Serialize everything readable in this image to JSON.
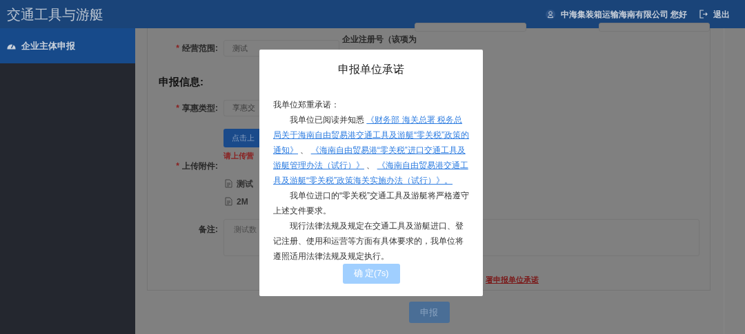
{
  "header": {
    "title": "交通工具与游艇",
    "user": "中海集装箱运输海南有限公司 您好",
    "logout": "退出"
  },
  "sidebar": {
    "items": [
      {
        "label": "企业主体申报",
        "selected": true
      }
    ]
  },
  "form": {
    "scope": {
      "label": "经营范围:",
      "required_mark": "*",
      "value": "测试"
    },
    "reg_label": "企业注册号（该项为",
    "section_title": "申报信息:",
    "type": {
      "label": "享惠类型:",
      "required_mark": "*",
      "value": "享惠交"
    },
    "upload_button": "点击上",
    "upload_hint": "请上传营",
    "attach": {
      "label": "上传附件:",
      "required_mark": "*",
      "files": [
        "测试",
        "2M"
      ]
    },
    "remark": {
      "label": "备注:",
      "value": "测试数"
    },
    "commit_link": "署申报单位承诺",
    "submit": "申报"
  },
  "dialog": {
    "title": "申报单位承诺",
    "paragraphs": [
      {
        "indent": false,
        "parts": [
          {
            "kind": "text",
            "text": "我单位郑重承诺："
          }
        ]
      },
      {
        "indent": true,
        "parts": [
          {
            "kind": "text",
            "text": "我单位已阅读并知悉 "
          },
          {
            "kind": "link",
            "text": "《财务部 海关总署 税务总局关于海南自由贸易港交通工具及游艇“零关税”政策的通知》"
          },
          {
            "kind": "text",
            "text": " 、 "
          },
          {
            "kind": "link",
            "text": "《海南自由贸易港“零关税”进口交通工具及游艇管理办法（试行）》"
          },
          {
            "kind": "text",
            "text": " 、 "
          },
          {
            "kind": "link",
            "text": "《海南自由贸易港交通工具及游艇“零关税”政策海关实施办法（试行）》。"
          }
        ]
      },
      {
        "indent": true,
        "parts": [
          {
            "kind": "text",
            "text": "我单位进口的“零关税”交通工具及游艇将严格遵守上述文件要求。"
          }
        ]
      },
      {
        "indent": true,
        "parts": [
          {
            "kind": "text",
            "text": "现行法律法规及规定在交通工具及游艇进口、登记注册、使用和运营等方面有具体要求的，我单位将遵照适用法律法规及规定执行。"
          }
        ]
      }
    ],
    "confirm": {
      "label": "确 定(7s)",
      "disabled": true
    }
  }
}
